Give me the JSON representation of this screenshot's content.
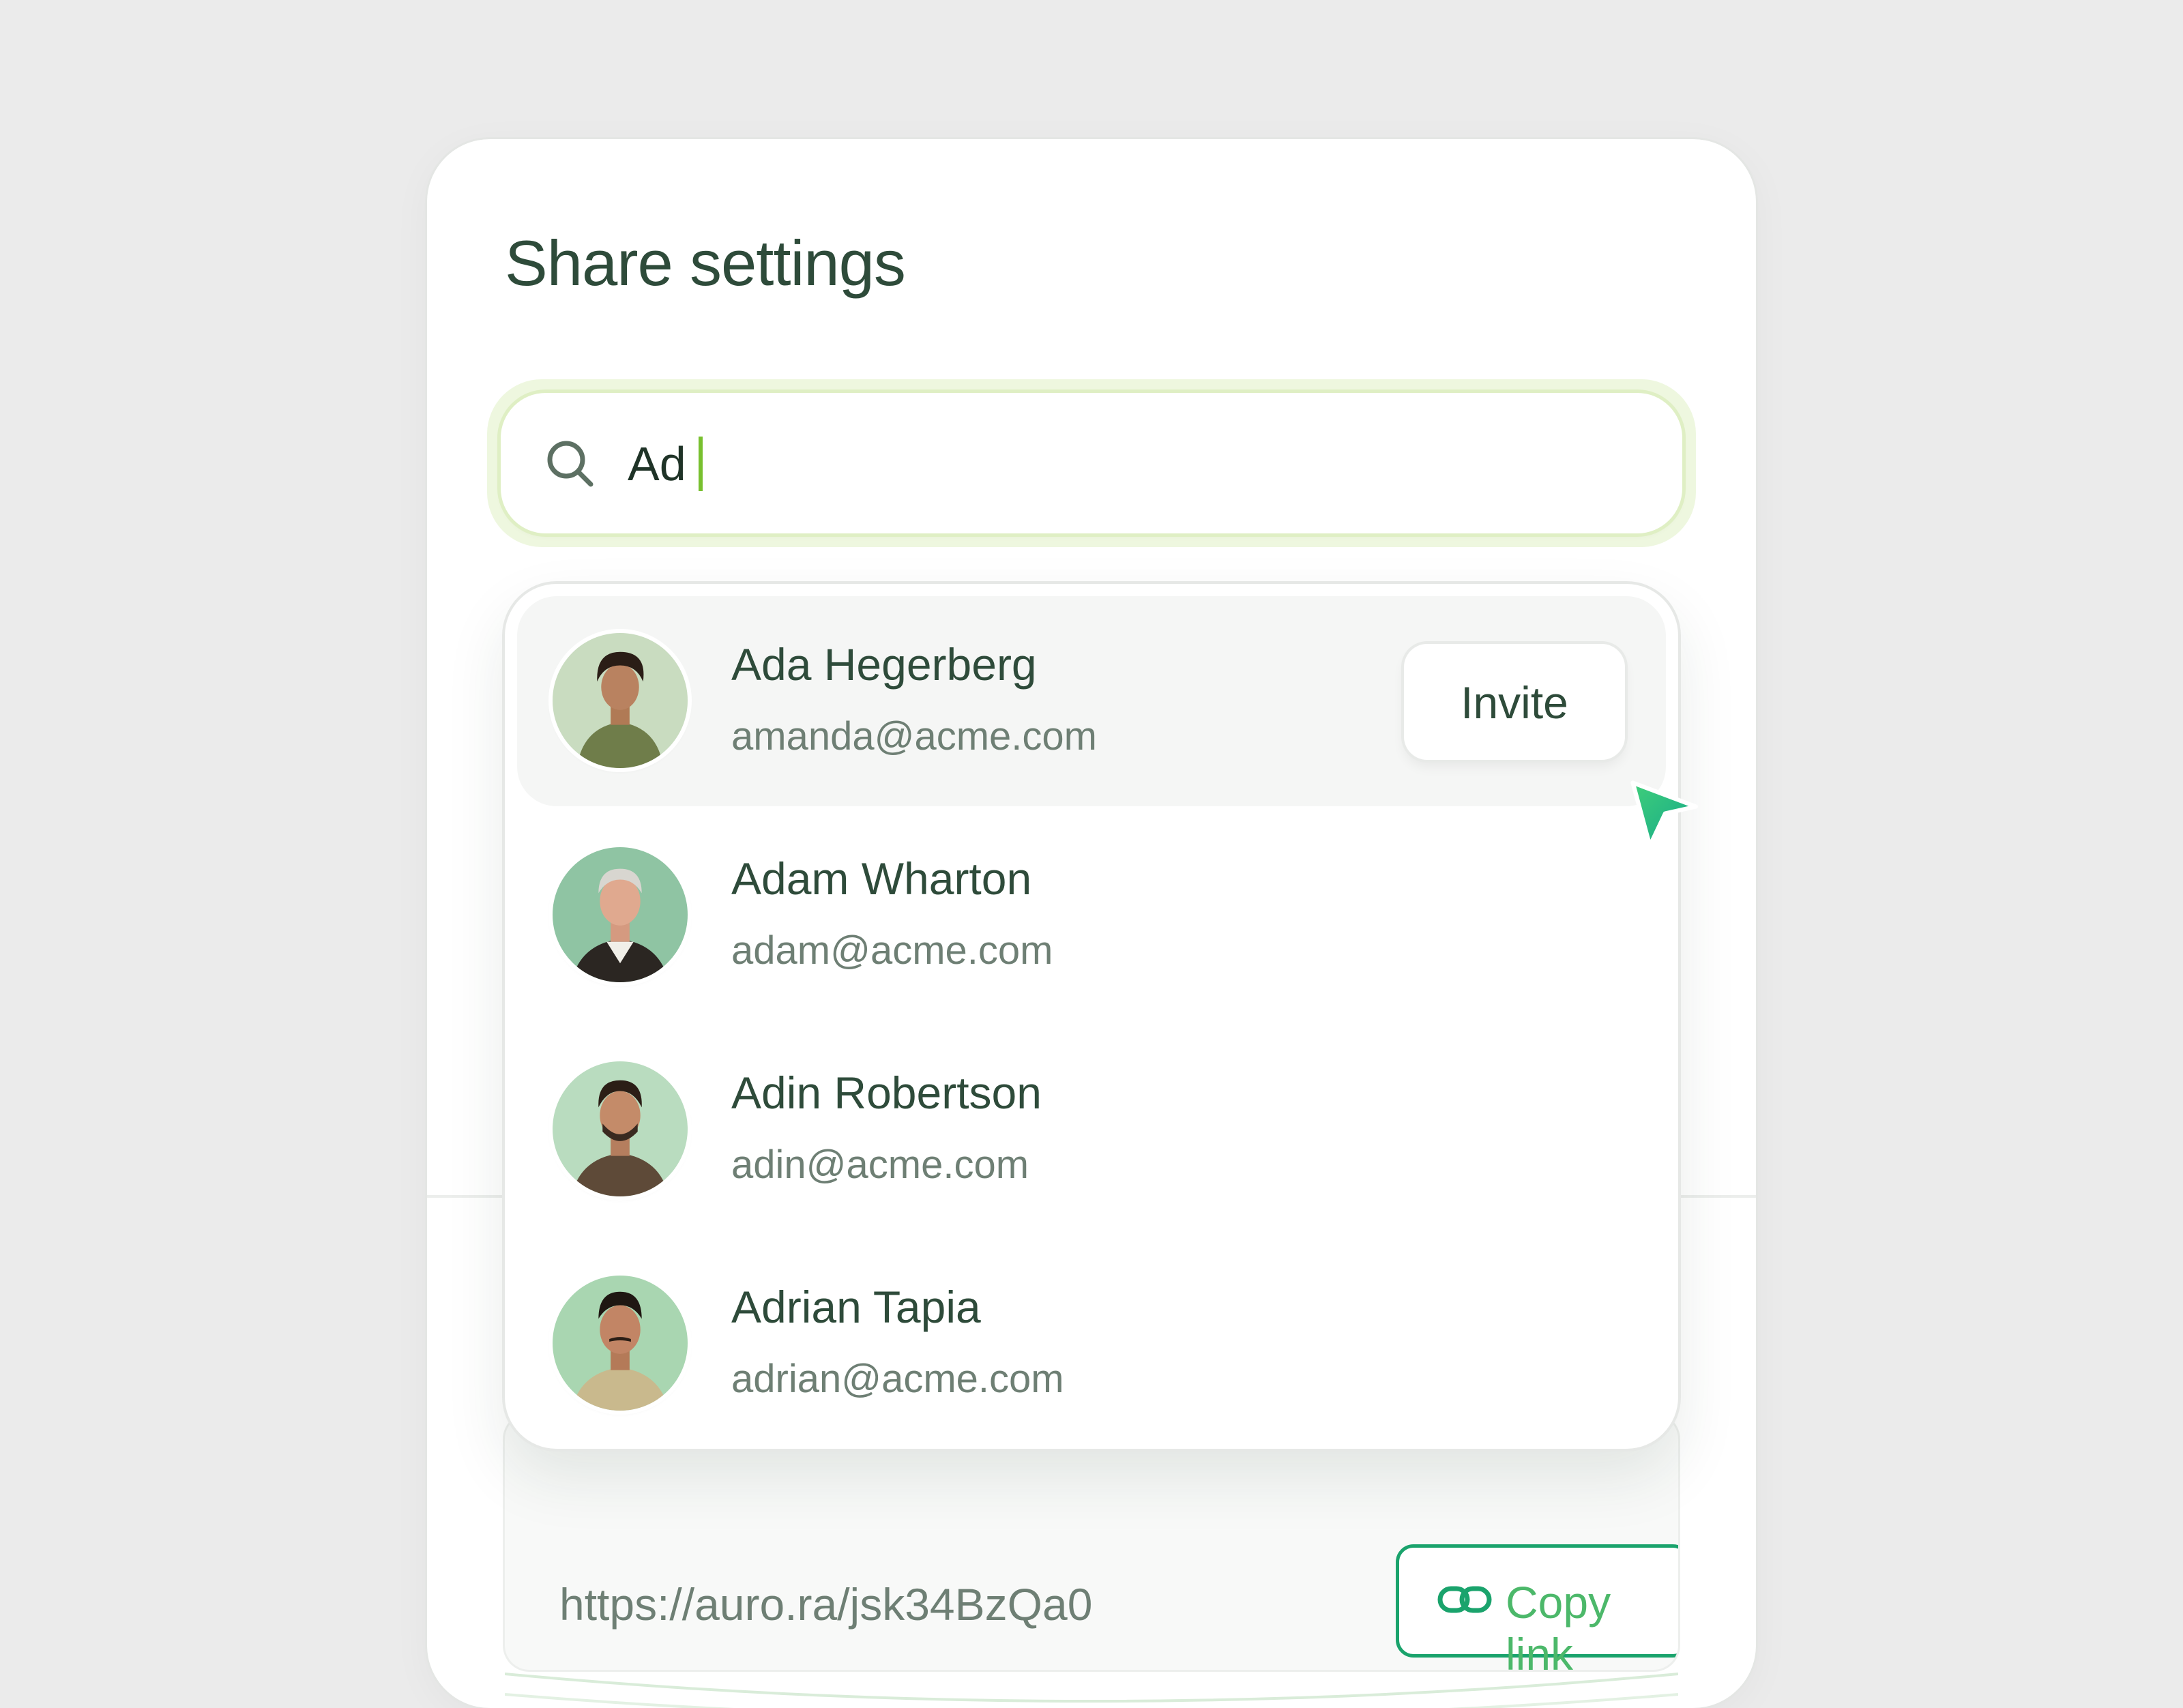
{
  "panel": {
    "title": "Share settings"
  },
  "search": {
    "value": "Ad"
  },
  "results": [
    {
      "name": "Ada Hegerberg",
      "email": "amanda@acme.com",
      "action": "Invite",
      "hovered": true
    },
    {
      "name": "Adam Wharton",
      "email": "adam@acme.com"
    },
    {
      "name": "Adin Robertson",
      "email": "adin@acme.com"
    },
    {
      "name": "Adrian Tapia",
      "email": "adrian@acme.com"
    }
  ],
  "share_link": {
    "url": "https://auro.ra/jsk34BzQa0",
    "copy_label": "Copy link"
  },
  "icons": [
    "search-icon",
    "link-icon",
    "cursor-arrow-icon"
  ],
  "colors": {
    "accent": "#1aa36c",
    "heading": "#2e4b3a",
    "caret": "#78c02e",
    "focus_ring": "#eef7df"
  }
}
